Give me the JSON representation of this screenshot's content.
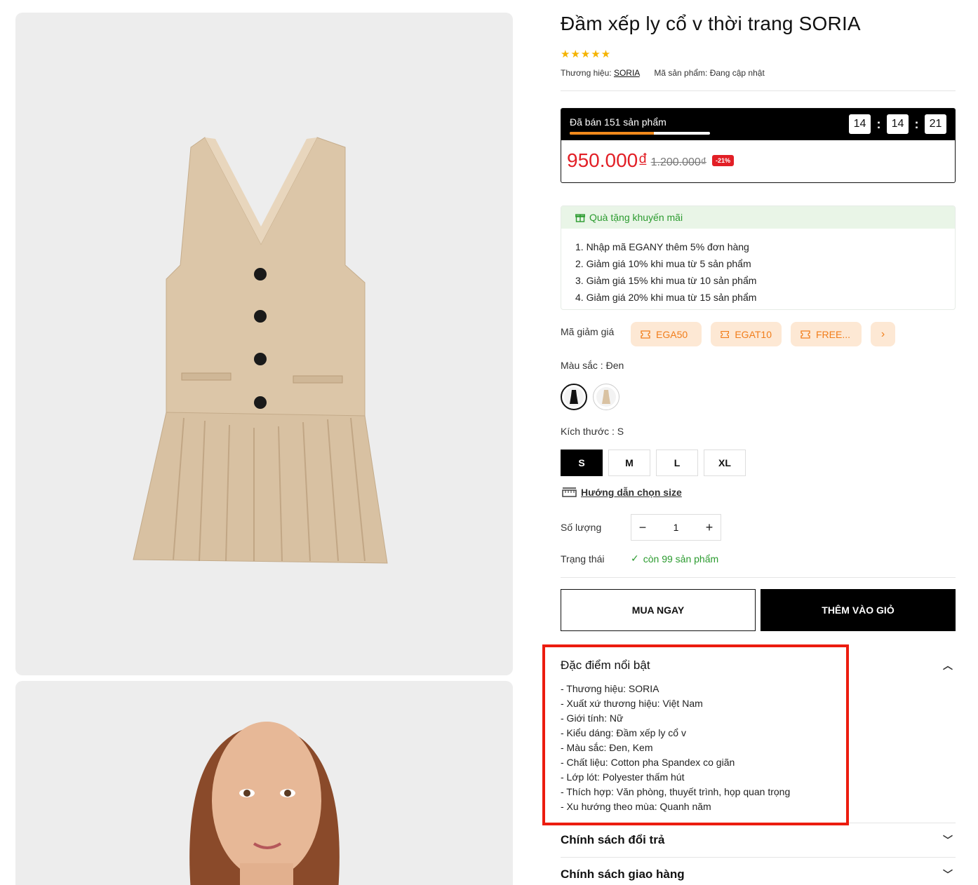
{
  "product": {
    "title": "Đầm xếp ly cổ v thời trang SORIA",
    "rating_stars": 5,
    "brand_label": "Thương hiệu:",
    "brand": "SORIA",
    "sku_label": "Mã sản phẩm:",
    "sku": "Đang cập nhật"
  },
  "flash_sale": {
    "sold_text": "Đã bán 151 sản phẩm",
    "sold_progress": 0.6,
    "timer": [
      "14",
      "14",
      "21"
    ],
    "price": "950.000₫",
    "old_price": "1.200.000₫",
    "discount": "-21%"
  },
  "promo": {
    "title": "Quà tặng khuyến mãi",
    "items": [
      "1. Nhập mã EGANY thêm 5% đơn hàng",
      "2. Giảm giá 10% khi mua từ 5 sản phẩm",
      "3. Giảm giá 15% khi mua từ 10 sản phẩm",
      "4. Giảm giá 20% khi mua từ 15 sản phẩm"
    ]
  },
  "coupons": {
    "label": "Mã giảm giá",
    "codes": [
      "EGA50",
      "EGAT10",
      "FREE..."
    ]
  },
  "color": {
    "label": "Màu sắc : Đen",
    "options": [
      "Đen",
      "Kem"
    ],
    "selected": 0
  },
  "size": {
    "label": "Kích thước : S",
    "options": [
      "S",
      "M",
      "L",
      "XL"
    ],
    "selected": 0,
    "guide": "Hướng dẫn chọn size"
  },
  "quantity": {
    "label": "Số lượng",
    "value": "1"
  },
  "status": {
    "label": "Trạng thái",
    "value": "còn 99 sản phẩm"
  },
  "actions": {
    "buy_now": "MUA NGAY",
    "add_to_cart": "THÊM VÀO GIỎ"
  },
  "accordion": {
    "features_title": "Đặc điểm nổi bật",
    "features": [
      "- Thương hiệu: SORIA",
      "- Xuất xứ thương hiệu: Việt Nam",
      "- Giới tính: Nữ",
      "- Kiểu dáng: Đầm xếp ly cổ v",
      "- Màu sắc: Đen, Kem",
      "- Chất liệu: Cotton pha Spandex co giãn",
      "- Lớp lót: Polyester thấm hút",
      "- Thích hợp: Văn phòng, thuyết trình, họp quan trọng",
      "- Xu hướng theo mùa: Quanh năm"
    ],
    "return_title": "Chính sách đổi trả",
    "shipping_title": "Chính sách giao hàng"
  },
  "colors": {
    "price_red": "#e21f26",
    "accent_green": "#2b9b2f",
    "coupon_orange": "#f17d1a",
    "highlight_red": "#ec1c0f"
  }
}
